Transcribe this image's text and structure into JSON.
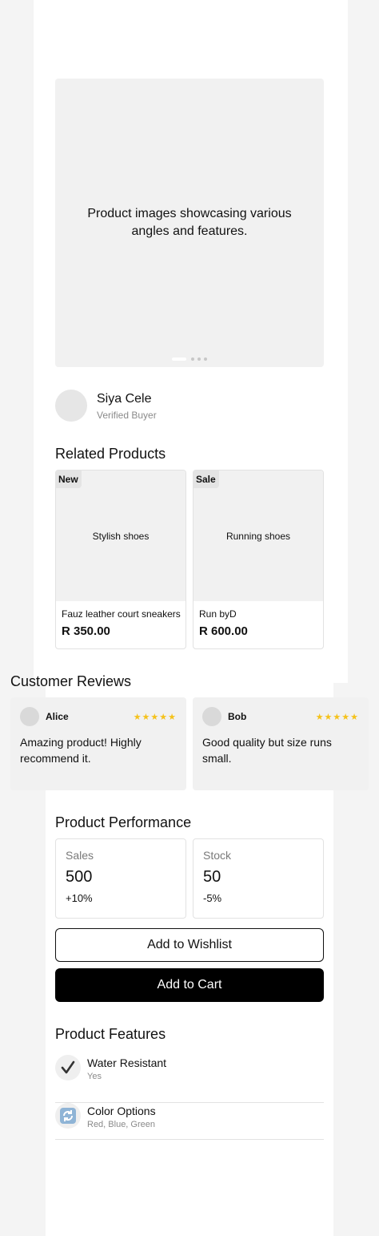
{
  "gallery": {
    "caption": "Product images showcasing various angles and features.",
    "slide_count": 4,
    "active_slide": 1
  },
  "reviewer": {
    "name": "Siya Cele",
    "status": "Verified Buyer"
  },
  "related": {
    "title": "Related Products",
    "items": [
      {
        "badge": "New",
        "image_label": "Stylish shoes",
        "name": "Fauz leather court sneakers",
        "price": "R 350.00"
      },
      {
        "badge": "Sale",
        "image_label": "Running shoes",
        "name": "Run byD",
        "price": "R 600.00"
      }
    ]
  },
  "reviews": {
    "title": "Customer Reviews",
    "items": [
      {
        "name": "Alice",
        "rating": 5,
        "stars": "★★★★★",
        "text": "Amazing product! Highly recommend it."
      },
      {
        "name": "Bob",
        "rating": 5,
        "stars": "★★★★★",
        "text": "Good quality but size runs small."
      }
    ],
    "star_color": "#f5c21b"
  },
  "performance": {
    "title": "Product Performance",
    "stats": [
      {
        "label": "Sales",
        "value": "500",
        "change": "+10%"
      },
      {
        "label": "Stock",
        "value": "50",
        "change": "-5%"
      }
    ]
  },
  "actions": {
    "wishlist_label": "Add to Wishlist",
    "cart_label": "Add to Cart"
  },
  "features": {
    "title": "Product Features",
    "items": [
      {
        "icon": "check-icon",
        "title": "Water Resistant",
        "value": "Yes"
      },
      {
        "icon": "refresh-icon",
        "title": "Color Options",
        "value": "Red, Blue, Green"
      }
    ]
  }
}
